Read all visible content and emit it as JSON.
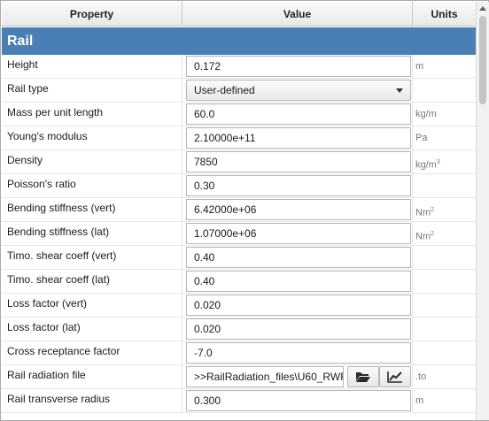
{
  "header": {
    "property": "Property",
    "value": "Value",
    "units": "Units"
  },
  "section": {
    "title": "Rail"
  },
  "rows": [
    {
      "label": "Height",
      "value": "0.172",
      "unit": "m"
    },
    {
      "label": "Rail type",
      "value": "User-defined",
      "unit": ""
    },
    {
      "label": "Mass per unit length",
      "value": "60.0",
      "unit": "kg/m"
    },
    {
      "label": "Young's modulus",
      "value": "2.10000e+11",
      "unit": "Pa"
    },
    {
      "label": "Density",
      "value": "7850",
      "unit": "kg/m",
      "unit_sup": "3"
    },
    {
      "label": "Poisson's ratio",
      "value": "0.30",
      "unit": ""
    },
    {
      "label": "Bending stiffness (vert)",
      "value": "6.42000e+06",
      "unit": "Nm",
      "unit_sup": "2"
    },
    {
      "label": "Bending stiffness (lat)",
      "value": "1.07000e+06",
      "unit": "Nm",
      "unit_sup": "2"
    },
    {
      "label": "Timo. shear coeff (vert)",
      "value": "0.40",
      "unit": ""
    },
    {
      "label": "Timo. shear coeff (lat)",
      "value": "0.40",
      "unit": ""
    },
    {
      "label": "Loss factor (vert)",
      "value": "0.020",
      "unit": ""
    },
    {
      "label": "Loss factor (lat)",
      "value": "0.020",
      "unit": ""
    },
    {
      "label": "Cross receptance factor",
      "value": "-7.0",
      "unit": ""
    },
    {
      "label": "Rail radiation file",
      "value": ">>RailRadiation_files\\U60_RWF",
      "unit": ".to"
    },
    {
      "label": "Rail transverse radius",
      "value": "0.300",
      "unit": "m"
    }
  ],
  "icons": {
    "open": "folder-open-icon",
    "plot": "line-chart-icon"
  }
}
